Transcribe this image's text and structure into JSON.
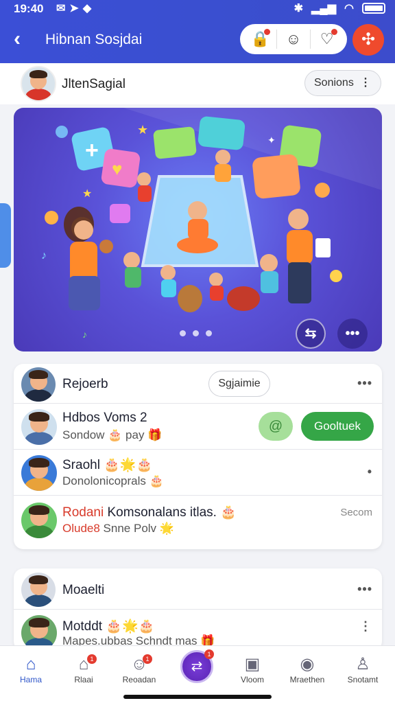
{
  "status_bar": {
    "time": "19:40"
  },
  "header": {
    "title": "Hibnan Sosjdai"
  },
  "profile": {
    "name": "JltenSagial",
    "sort_label": "Sonions"
  },
  "hero": {
    "dots_count": 3
  },
  "card1": {
    "header_row": {
      "name": "Rejoerb",
      "pill_label": "Sgjaimie"
    },
    "rows": [
      {
        "name": "Hdbos Voms 2",
        "sub": "Sondow 🎂 pay 🎁",
        "button_label": "Gooltuek"
      },
      {
        "name": "Sraohl 🎂🌟🎂",
        "sub": "Donolonicoprals 🎂"
      },
      {
        "name_red": "Rodani",
        "name_rest": " Komsonalans itlas. 🎂",
        "sub_red": "Olude8",
        "sub_rest": " Snne Polv 🌟",
        "meta": "Secom"
      }
    ]
  },
  "card2": {
    "header_row": {
      "name": "Moaelti"
    },
    "rows": [
      {
        "name": "Motddt 🎂🌟🎂",
        "sub": "Mapes.ubbas Schndt mas 🎁"
      }
    ]
  },
  "bottom_nav": [
    {
      "label": "Hama",
      "icon": "home-icon"
    },
    {
      "label": "Rlaai",
      "icon": "shop-icon",
      "badge": "1"
    },
    {
      "label": "Reoadan",
      "icon": "chat-icon",
      "badge": "1"
    },
    {
      "label": "",
      "icon": "create-icon",
      "badge": "1"
    },
    {
      "label": "Vloom",
      "icon": "video-icon"
    },
    {
      "label": "Mraethen",
      "icon": "market-icon"
    },
    {
      "label": "Snotamt",
      "icon": "profile-icon"
    }
  ]
}
